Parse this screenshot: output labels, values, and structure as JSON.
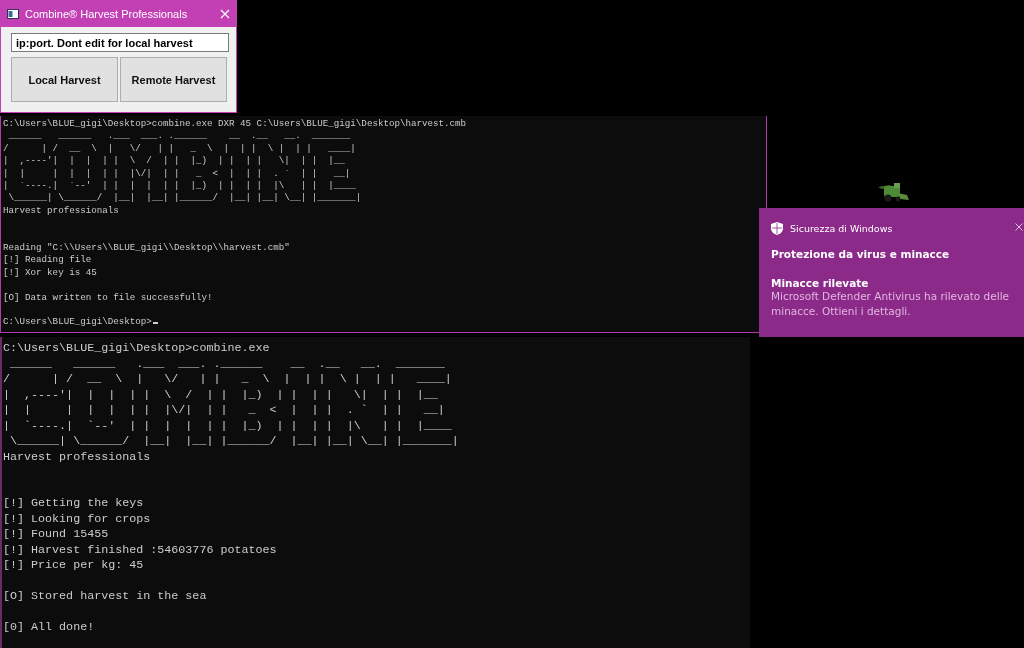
{
  "app_window": {
    "title": "Combine® Harvest Professionals",
    "field": {
      "value": "ip:port. Dont edit for local harvest"
    },
    "buttons": [
      "Local Harvest",
      "Remote Harvest"
    ]
  },
  "consoles": [
    {
      "command": "C:\\Users\\BLUE_gigi\\Desktop>combine.exe DXR 45 C:\\Users\\BLUE_gigi\\Desktop\\harvest.cmb",
      "banner": [
        " ______   ______   .___  ___. .______    __  .__   __.  _______ ",
        "/      | /  __  \\  |   \\/   | |   _  \\  |  | |  \\ |  | |   ____|",
        "|  ,----'|  |  |  | |  \\  /  | |  |_)  | |  | |   \\|  | |  |__   ",
        "|  |     |  |  |  | |  |\\/|  | |   _  <  |  | |  . `  | |   __|  ",
        "|  `----.|  `--'  | |  |  |  | |  |_)  | |  | |  |\\   | |  |____ ",
        " \\______| \\______/  |__|  |__| |______/  |__| |__| \\__| |_______|"
      ],
      "tagline": "Harvest professionals",
      "log_groups": [
        [
          "Reading \"C:\\\\Users\\\\BLUE_gigi\\\\Desktop\\\\harvest.cmb\"",
          "[!] Reading file",
          "[!] Xor key is 45"
        ],
        [
          "[O] Data written to file successfully!"
        ],
        [
          "C:\\Users\\BLUE_gigi\\Desktop>"
        ]
      ],
      "cursor": true
    },
    {
      "command": "C:\\Users\\BLUE_gigi\\Desktop>combine.exe",
      "banner": [
        " ______   ______   .___  ___. .______    __  .__   __.  _______ ",
        "/      | /  __  \\  |   \\/   | |   _  \\  |  | |  \\ |  | |   ____|",
        "|  ,----'|  |  |  | |  \\  /  | |  |_)  | |  | |   \\|  | |  |__   ",
        "|  |     |  |  |  | |  |\\/|  | |   _  <  |  | |  . `  | |   __|  ",
        "|  `----.|  `--'  | |  |  |  | |  |_)  | |  | |  |\\   | |  |____ ",
        " \\______| \\______/  |__|  |__| |______/  |__| |__| \\__| |_______|"
      ],
      "tagline": "Harvest professionals",
      "log_groups": [
        [
          "[!] Getting the keys",
          "[!] Looking for crops",
          "[!] Found 15455",
          "[!] Harvest finished :54603776 potatoes",
          "[!] Price per kg: 45"
        ],
        [
          "[O] Stored harvest in the sea"
        ],
        [
          "[0] All done!"
        ]
      ],
      "cursor": false
    }
  ],
  "notification": {
    "app": "Sicurezza di Windows",
    "heading": "Protezione da virus e minacce",
    "title": "Minacce rilevate",
    "body": "Microsoft Defender Antivirus ha rilevato delle minacce. Ottieni i dettagli."
  }
}
